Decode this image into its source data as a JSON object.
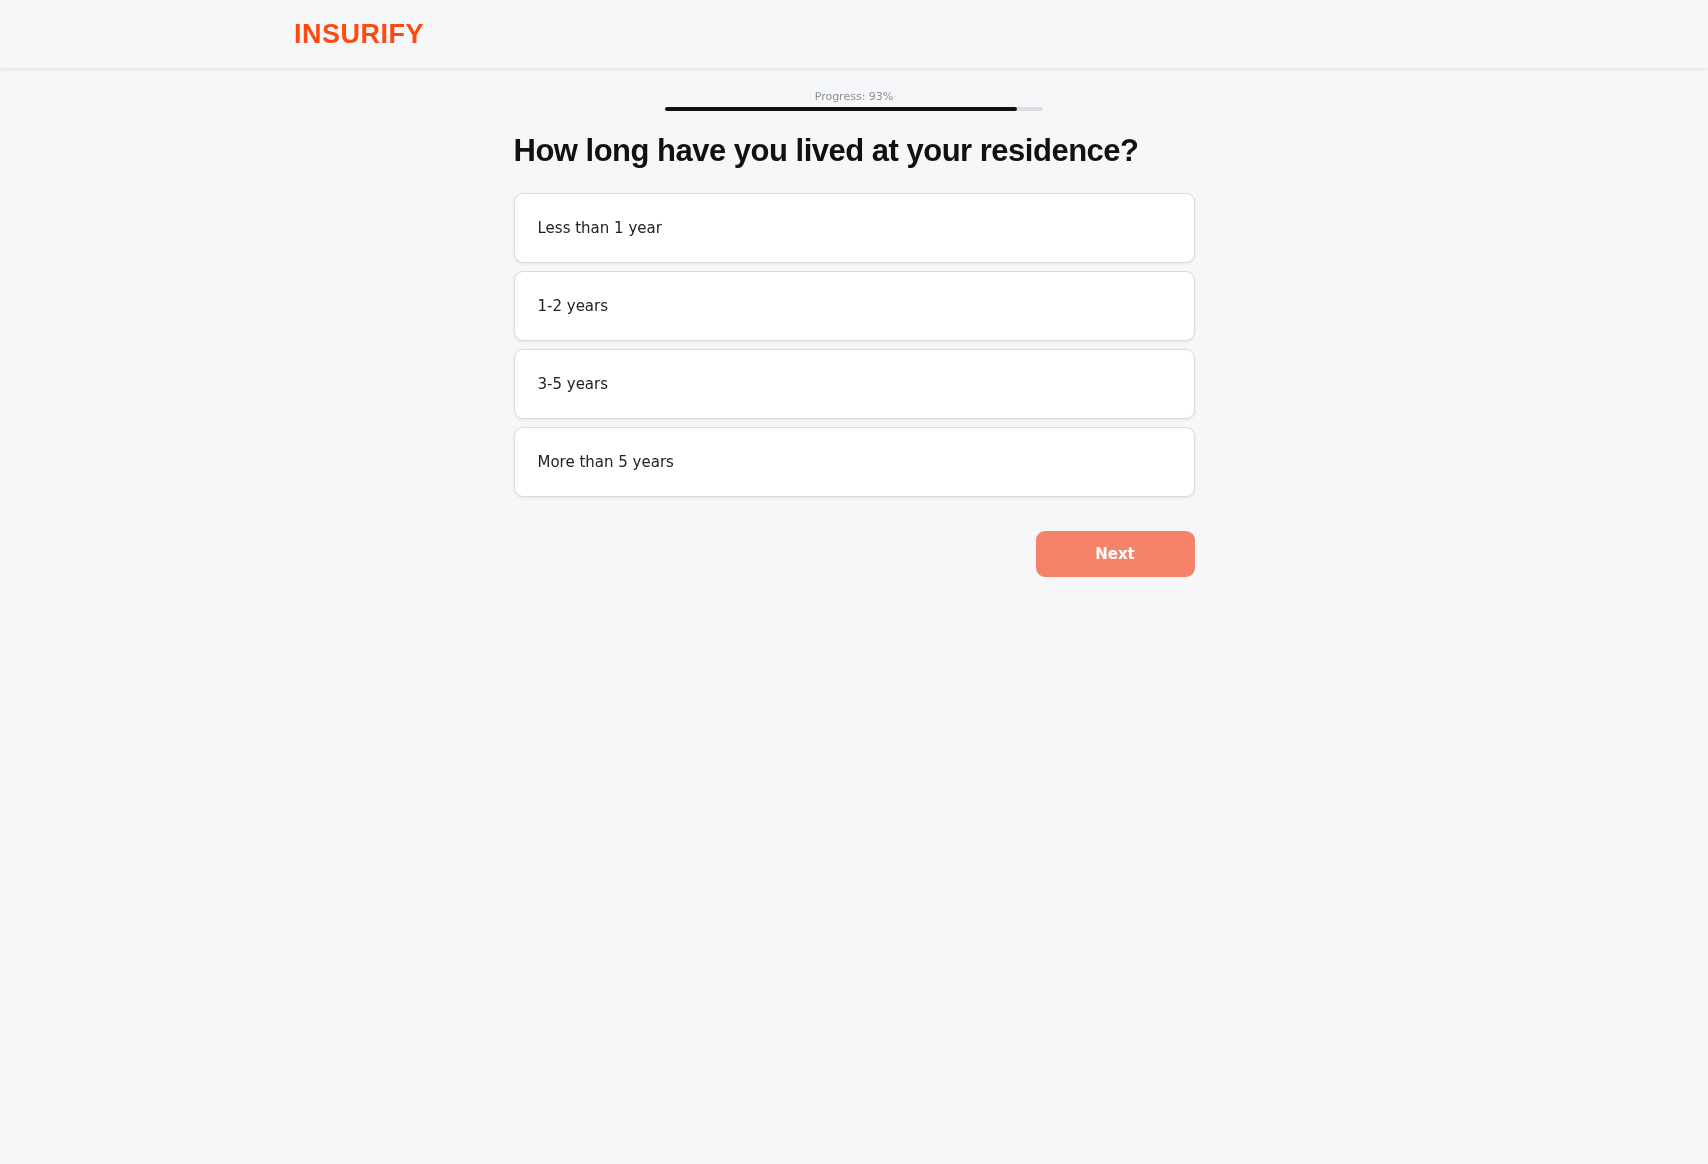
{
  "header": {
    "logo": "INSURIFY"
  },
  "progress": {
    "label": "Progress: 93%",
    "level": 0.93
  },
  "question": "How long have you lived at your residence?",
  "options": [
    {
      "label": "Less than 1 year",
      "selected": false
    },
    {
      "label": "1-2 years",
      "selected": false
    },
    {
      "label": "3-5 years",
      "selected": false
    },
    {
      "label": "More than 5 years",
      "selected": false
    }
  ],
  "next_button": {
    "label": "Next",
    "disabled": true
  }
}
